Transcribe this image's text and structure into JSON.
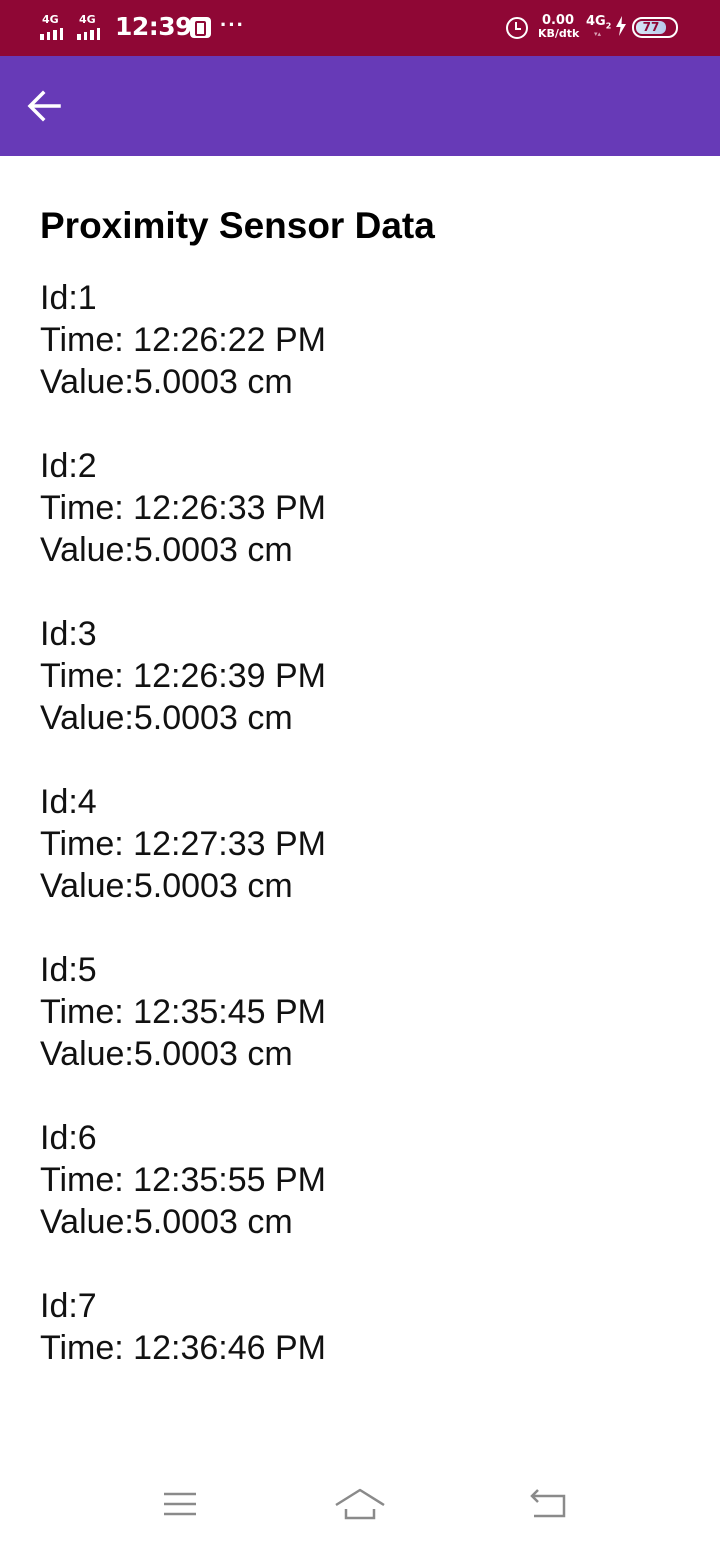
{
  "status_bar": {
    "network_1": "4G",
    "network_2": "4G",
    "time": "12:39",
    "more": "···",
    "speed_value": "0.00",
    "speed_unit": "KB/dtk",
    "network_3": "4G",
    "network_3_sub": "2",
    "battery": "77"
  },
  "page": {
    "title": "Proximity Sensor Data"
  },
  "records": [
    {
      "id": "Id:1",
      "time": "Time: 12:26:22 PM",
      "value": "Value:5.0003 cm"
    },
    {
      "id": "Id:2",
      "time": "Time: 12:26:33 PM",
      "value": "Value:5.0003 cm"
    },
    {
      "id": "Id:3",
      "time": "Time: 12:26:39 PM",
      "value": "Value:5.0003 cm"
    },
    {
      "id": "Id:4",
      "time": "Time: 12:27:33 PM",
      "value": "Value:5.0003 cm"
    },
    {
      "id": "Id:5",
      "time": "Time: 12:35:45 PM",
      "value": "Value:5.0003 cm"
    },
    {
      "id": "Id:6",
      "time": "Time: 12:35:55 PM",
      "value": "Value:5.0003 cm"
    },
    {
      "id": "Id:7",
      "time": "Time: 12:36:46 PM"
    }
  ],
  "icons": {
    "back": "arrow-left",
    "nav_menu": "menu-lines",
    "nav_home": "home",
    "nav_back": "return"
  },
  "colors": {
    "status_bar": "#8f0735",
    "app_bar": "#673ab7"
  }
}
